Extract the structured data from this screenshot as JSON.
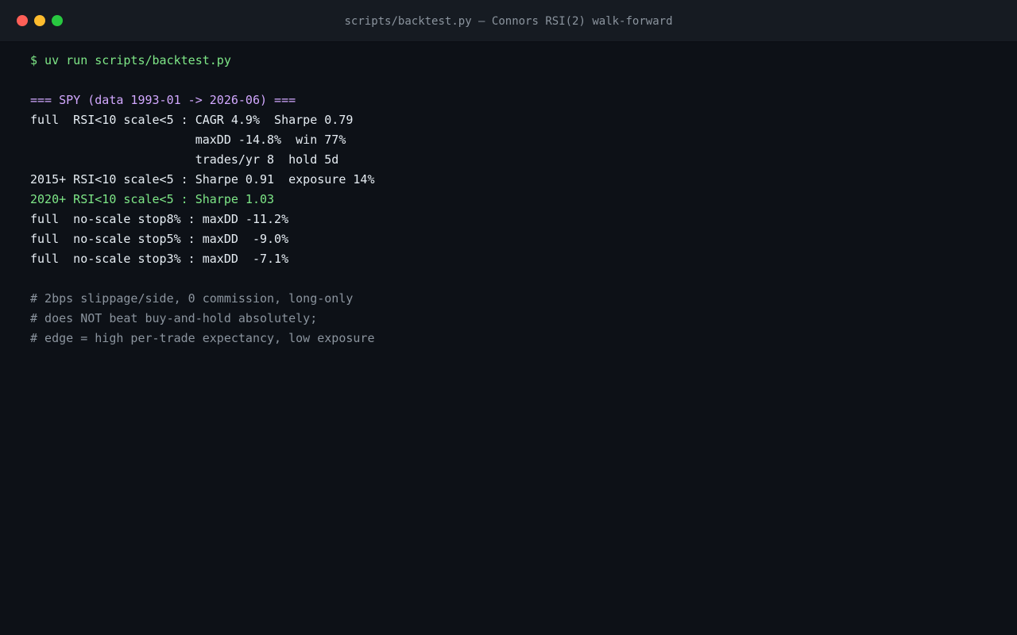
{
  "window": {
    "title": "scripts/backtest.py — Connors RSI(2) walk-forward",
    "controls": {
      "close_color": "#ff5f57",
      "minimize_color": "#febc2e",
      "zoom_color": "#28c840"
    }
  },
  "colors": {
    "background": "#0d1117",
    "titlebar": "#161b22",
    "command": "#7ee787",
    "header": "#d2a8ff",
    "output": "#e6edf3",
    "highlight": "#7ee787",
    "comment": "#8b949e"
  },
  "terminal": {
    "lines": [
      {
        "kind": "command",
        "text": "$ uv run scripts/backtest.py"
      },
      {
        "kind": "blank",
        "text": ""
      },
      {
        "kind": "header",
        "text": "=== SPY (data 1993-01 -> 2026-06) ==="
      },
      {
        "kind": "output",
        "text": "full  RSI<10 scale<5 : CAGR 4.9%  Sharpe 0.79"
      },
      {
        "kind": "output",
        "text": "                       maxDD -14.8%  win 77%"
      },
      {
        "kind": "output",
        "text": "                       trades/yr 8  hold 5d"
      },
      {
        "kind": "output",
        "text": "2015+ RSI<10 scale<5 : Sharpe 0.91  exposure 14%"
      },
      {
        "kind": "highlight",
        "text": "2020+ RSI<10 scale<5 : Sharpe 1.03"
      },
      {
        "kind": "output",
        "text": "full  no-scale stop8% : maxDD -11.2%"
      },
      {
        "kind": "output",
        "text": "full  no-scale stop5% : maxDD  -9.0%"
      },
      {
        "kind": "output",
        "text": "full  no-scale stop3% : maxDD  -7.1%"
      },
      {
        "kind": "blank",
        "text": ""
      },
      {
        "kind": "comment",
        "text": "# 2bps slippage/side, 0 commission, long-only"
      },
      {
        "kind": "comment",
        "text": "# does NOT beat buy-and-hold absolutely;"
      },
      {
        "kind": "comment",
        "text": "# edge = high per-trade expectancy, low exposure"
      }
    ]
  }
}
